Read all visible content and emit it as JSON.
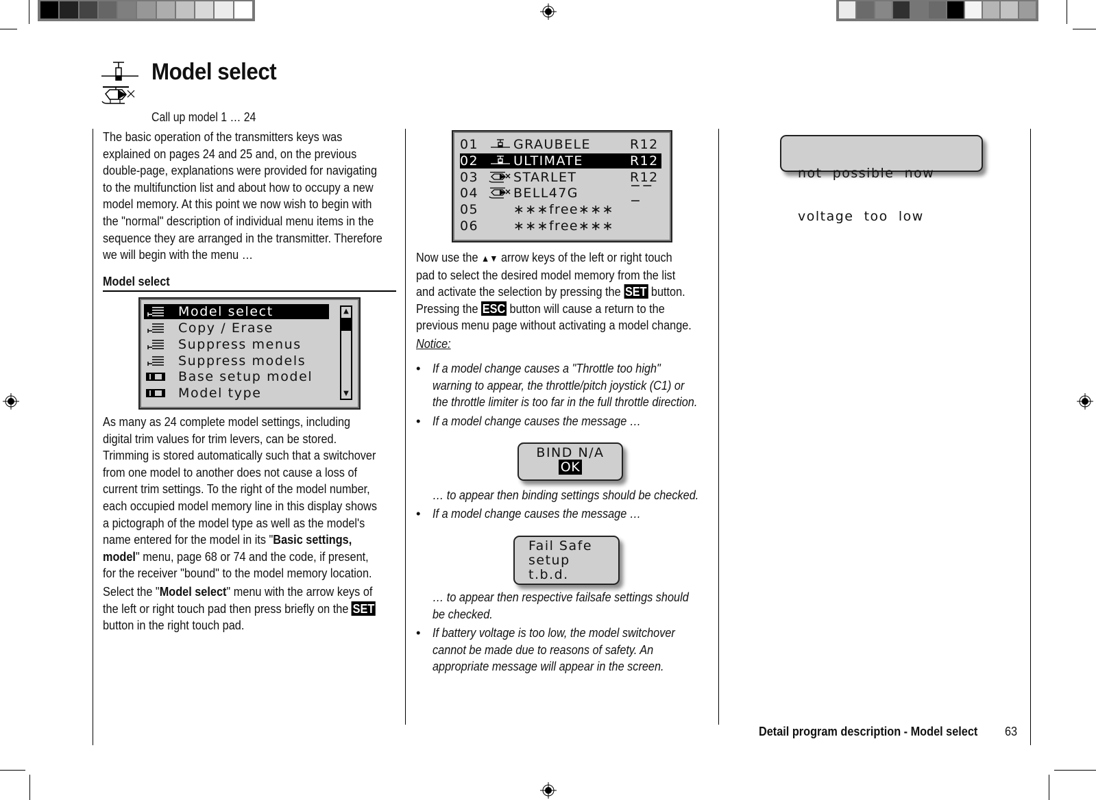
{
  "header": {
    "title": "Model select",
    "subtitle": "Call up model 1 … 24",
    "icons": [
      "airplane-icon",
      "helicopter-icon"
    ]
  },
  "calibration": {
    "left_swatches": [
      "#000000",
      "#222222",
      "#444444",
      "#666666",
      "#7f7f7f",
      "#979797",
      "#adadad",
      "#c2c2c2",
      "#d8d8d8",
      "#ececec",
      "#ffffff"
    ],
    "right_swatches": [
      "#ebebeb",
      "#6b6b6b",
      "#878787",
      "#303030",
      "#767676",
      "#6a6a6a",
      "#000000",
      "#f4f4f4",
      "#b5b5b5",
      "#c3c3c3",
      "#9c9c9c"
    ]
  },
  "column1": {
    "intro_lines": [
      "The basic operation of the transmitters keys was",
      "explained on pages 24 and 25 and, on the previous",
      "double-page, explanations were provided for navigating",
      "to the multifunction list and about how to occupy a new",
      "model memory. At this point we now wish to begin with",
      "the \"normal\" description of individual menu items in the",
      "sequence they are arranged in the transmitter. Therefore",
      "we will begin with the menu …"
    ],
    "section_heading": "Model select",
    "menu_screen": {
      "items": [
        {
          "label": "Model select",
          "icon": "list-icon",
          "selected": true
        },
        {
          "label": "Copy / Erase",
          "icon": "list-icon",
          "selected": false
        },
        {
          "label": "Suppress menus",
          "icon": "list-icon",
          "selected": false
        },
        {
          "label": "Suppress models",
          "icon": "list-icon",
          "selected": false
        },
        {
          "label": "Base setup model",
          "icon": "module-icon",
          "selected": false
        },
        {
          "label": "Model type",
          "icon": "module-icon",
          "selected": false
        }
      ],
      "scroll_up": "▲",
      "scroll_down": "▼"
    },
    "body_lines": [
      "As many as 24 complete model settings, including",
      "digital trim values for trim levers, can be stored.",
      "Trimming is stored automatically such that a switchover",
      "from one model to another does not cause a loss of",
      "current trim settings. To the right of the model number,",
      "each occupied model memory line in this display shows",
      "a pictograph of the model type as well as the model's"
    ],
    "body_line8_pre": "name entered for the model in its \"",
    "body_line8_bold": "Basic settings,",
    "body_line9_bold": "model",
    "body_line9_post": "\" menu, page 68 or 74 and the code, if present,",
    "body_line10": "for the receiver \"bound\" to the model memory location.",
    "select_pre": "Select the \"",
    "select_bold": "Model select",
    "select_post": "\" menu with the arrow keys of",
    "select_line2": "the left or right touch pad then press briefly on the ",
    "select_key": "SET",
    "select_line3": "button in the right touch pad."
  },
  "column2": {
    "model_screen": {
      "rows": [
        {
          "num": "01",
          "type": "airplane-icon",
          "name": "GRAUBELE",
          "code": "R12",
          "selected": false
        },
        {
          "num": "02",
          "type": "airplane-icon",
          "name": "ULTIMATE",
          "code": "R12",
          "selected": true
        },
        {
          "num": "03",
          "type": "helicopter-icon",
          "name": "STARLET",
          "code": "R12",
          "selected": false
        },
        {
          "num": "04",
          "type": "helicopter-icon",
          "name": "BELL47G",
          "code": "−−−",
          "selected": false
        },
        {
          "num": "05",
          "type": "",
          "name": "∗∗∗free∗∗∗",
          "code": "",
          "selected": false
        },
        {
          "num": "06",
          "type": "",
          "name": "∗∗∗free∗∗∗",
          "code": "",
          "selected": false
        }
      ]
    },
    "nav_line1_pre": "Now use the ",
    "nav_arrows": "▲▼",
    "nav_line1_post": " arrow keys of the left or right touch",
    "nav_line2": "pad to select the desired model memory from the list",
    "nav_line3_pre": "and activate the selection by pressing the ",
    "nav_key_set": "SET",
    "nav_line3_post": " button.",
    "nav_line4_pre": "Pressing the ",
    "nav_key_esc": "ESC",
    "nav_line4_post": " button will cause a return to the",
    "nav_line5": "previous menu page without activating a model change.",
    "notice_label": "Notice:",
    "bullets": [
      {
        "lines": [
          "If a model change causes a \"Throttle too high\"",
          "warning to appear, the throttle/pitch joystick (C1) or",
          "the throttle limiter is too far in the full throttle direction."
        ]
      },
      {
        "lines": [
          "If a model change causes the message …"
        ]
      },
      {
        "lines": [
          "If a model change causes the message …"
        ]
      },
      {
        "lines": [
          "If battery voltage is too low, the model switchover",
          "cannot be made due to reasons of safety. An",
          "appropriate message will appear in the screen."
        ]
      }
    ],
    "bind_popup": {
      "line1": "BIND N/A",
      "button": "OK"
    },
    "bind_followup": "… to appear then binding settings should be checked.",
    "failsafe_popup": {
      "lines": [
        "Fail Safe",
        "setup",
        "t.b.d."
      ]
    },
    "failsafe_followup": [
      "… to appear then respective failsafe settings should",
      "be checked."
    ]
  },
  "column3": {
    "voltage_popup": {
      "lines": [
        "not  possible  now",
        "voltage  too  low"
      ]
    }
  },
  "footer": {
    "section": "Detail program description - Model select",
    "page_number": "63"
  }
}
